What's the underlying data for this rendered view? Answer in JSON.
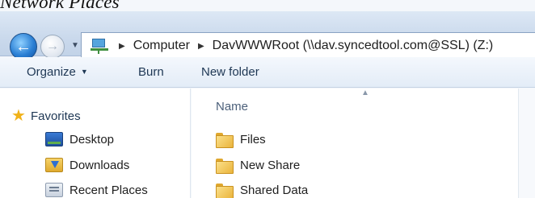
{
  "caption": "Network Places",
  "address_bar": {
    "location_icon": "network-location-icon",
    "crumbs": [
      "Computer",
      "DavWWWRoot (\\\\dav.syncedtool.com@SSL) (Z:)"
    ]
  },
  "toolbar": {
    "organize_label": "Organize",
    "burn_label": "Burn",
    "new_folder_label": "New folder"
  },
  "nav_pane": {
    "favorites_label": "Favorites",
    "items": [
      {
        "label": "Desktop",
        "icon": "desktop-icon"
      },
      {
        "label": "Downloads",
        "icon": "downloads-icon"
      },
      {
        "label": "Recent Places",
        "icon": "recent-places-icon"
      }
    ]
  },
  "file_list": {
    "column_name": "Name",
    "rows": [
      {
        "name": "Files",
        "icon": "folder-icon"
      },
      {
        "name": "New Share",
        "icon": "folder-icon"
      },
      {
        "name": "Shared Data",
        "icon": "folder-icon"
      }
    ]
  }
}
